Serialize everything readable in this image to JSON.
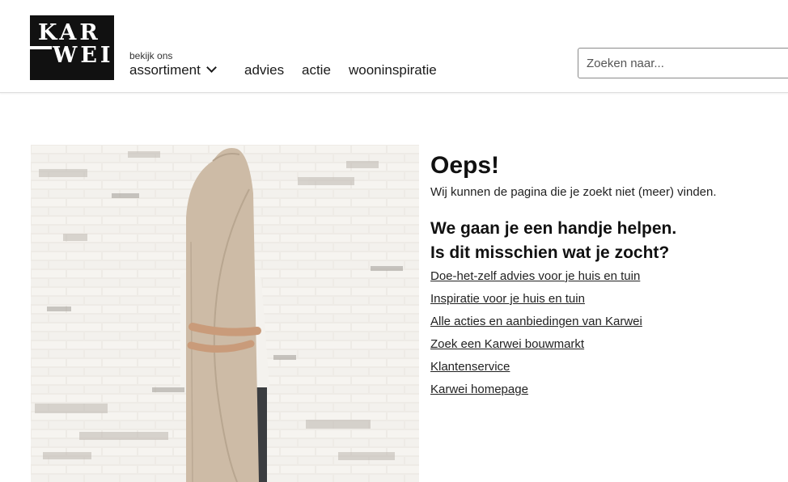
{
  "header": {
    "logo": {
      "line1": "KAR",
      "line2": "WEI"
    },
    "nav_sub": "bekijk ons",
    "nav": {
      "assortiment": "assortiment",
      "advies": "advies",
      "actie": "actie",
      "wooninspiratie": "wooninspiratie"
    },
    "search": {
      "placeholder": "Zoeken naar..."
    }
  },
  "error": {
    "title": "Oeps!",
    "message": "Wij kunnen de pagina die je zoekt niet (meer) vinden."
  },
  "help": {
    "heading_line1": "We gaan je een handje helpen.",
    "heading_line2": "Is dit misschien wat je zocht?",
    "links": [
      "Doe-het-zelf advies voor je huis en tuin",
      "Inspiratie voor je huis en tuin",
      "Alle acties en aanbiedingen van Karwei",
      "Zoek een Karwei bouwmarkt",
      "Klantenservice",
      "Karwei homepage"
    ]
  },
  "colors": {
    "logo_bg": "#111111",
    "text": "#1a1a1a",
    "wall": "#ece9e4",
    "rug": "#cdbba6"
  }
}
